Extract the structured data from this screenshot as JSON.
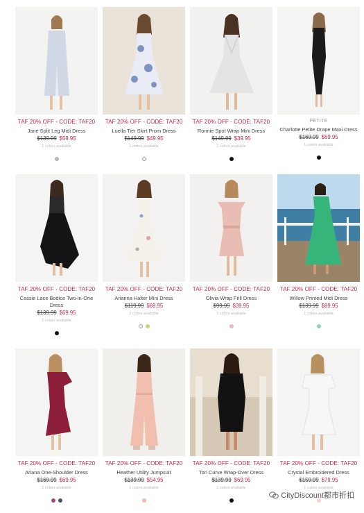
{
  "promo_text": "TAF 20% OFF - CODE: TAF20",
  "watermark": "CityDiscount都市折扣",
  "products": [
    {
      "name": "Jane Split Leg Midi Dress",
      "was": "$139.99",
      "now": "$59.95",
      "availability": "1 colors available",
      "badge": "",
      "swatches": [
        "#b5b5b5"
      ]
    },
    {
      "name": "Luella Tier Skirt Prom Dress",
      "was": "$149.99",
      "now": "$49.95",
      "availability": "1 colors available",
      "badge": "",
      "swatches": [
        "#ffffff"
      ]
    },
    {
      "name": "Ronnie Spot Wrap Mini Dress",
      "was": "$149.99",
      "now": "$39.95",
      "availability": "1 colors available",
      "badge": "",
      "swatches": [
        "#111111"
      ]
    },
    {
      "name": "Charlotte Petite Drape Maxi Dress",
      "was": "$169.99",
      "now": "$69.95",
      "availability": "1 colors available",
      "badge": "PETITE",
      "swatches": [
        "#111111"
      ]
    },
    {
      "name": "Cassie Lace Bodice Two-in-One Dress",
      "was": "$139.99",
      "now": "$69.95",
      "availability": "1 colors available",
      "badge": "",
      "swatches": [
        "#111111"
      ]
    },
    {
      "name": "Arianna Halter Mini Dress",
      "was": "$119.99",
      "now": "$69.95",
      "availability": "2 colors available",
      "badge": "",
      "swatches": [
        "#ffffff",
        "#cfd08a"
      ]
    },
    {
      "name": "Olivia Wrap Frill Dress",
      "was": "$99.99",
      "now": "$39.95",
      "availability": "1 colors available",
      "badge": "",
      "swatches": [
        "#e8b9c3"
      ]
    },
    {
      "name": "Willow Printed Midi Dress",
      "was": "$139.99",
      "now": "$89.95",
      "availability": "1 colors available",
      "badge": "",
      "swatches": [
        "#8fcfbd"
      ]
    },
    {
      "name": "Ariana One-Shoulder Dress",
      "was": "$169.99",
      "now": "$69.95",
      "availability": "2 colors available",
      "badge": "",
      "swatches": [
        "#a2477a",
        "#4a5270"
      ]
    },
    {
      "name": "Heather Utility Jumpsuit",
      "was": "$139.99",
      "now": "$54.95",
      "availability": "1 colors available",
      "badge": "",
      "swatches": [
        "#f2b9b0"
      ]
    },
    {
      "name": "Tori Curve Wrap-Over Dress",
      "was": "$139.99",
      "now": "$69.95",
      "availability": "1 colors available",
      "badge": "",
      "swatches": [
        "#111111"
      ]
    },
    {
      "name": "Crystal Embroidered Dress",
      "was": "$159.99",
      "now": "$79.95",
      "availability": "1 colors available",
      "badge": "",
      "swatches": [
        "#f3d3cf"
      ]
    }
  ]
}
